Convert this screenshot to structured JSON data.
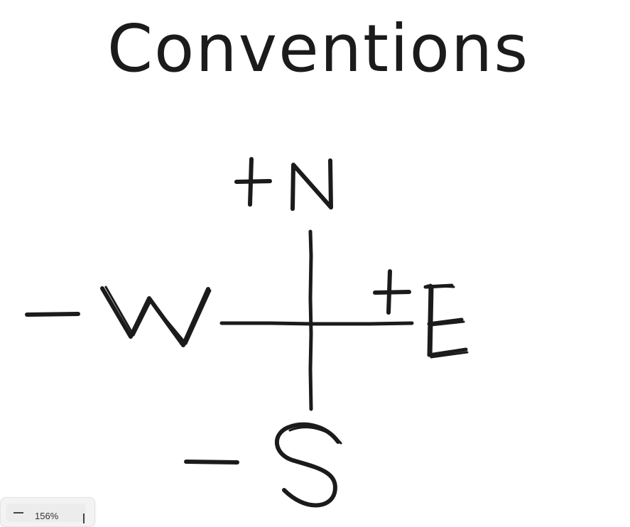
{
  "title": "Conventions",
  "labels": {
    "north": "+N",
    "south": "−S",
    "east": "+E",
    "west": "−W"
  },
  "zoom": {
    "level": "156%"
  },
  "colors": {
    "ink": "#1b1b1b",
    "background": "#ffffff"
  },
  "icons": {
    "zoom_out": "minus-icon",
    "zoom_in": "plus-icon"
  }
}
